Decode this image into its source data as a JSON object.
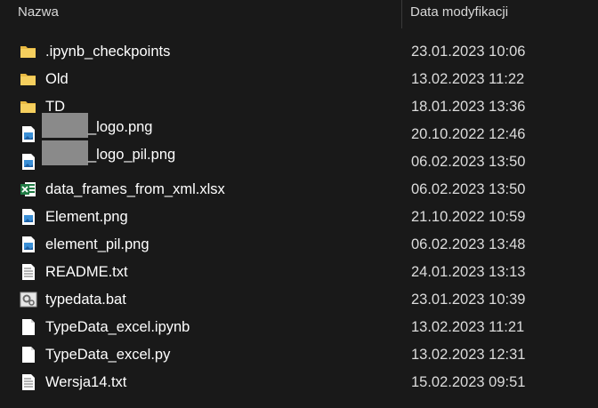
{
  "header": {
    "name_label": "Nazwa",
    "date_label": "Data modyfikacji"
  },
  "files": [
    {
      "name": ".ipynb_checkpoints",
      "date": "23.01.2023 10:06",
      "icon": "folder-icon"
    },
    {
      "name": "Old",
      "date": "13.02.2023 11:22",
      "icon": "folder-icon"
    },
    {
      "name": "TD",
      "date": "18.01.2023 13:36",
      "icon": "folder-icon"
    },
    {
      "name": "_logo.png",
      "date": "20.10.2022 12:46",
      "icon": "image-file-icon",
      "redacted": true
    },
    {
      "name": "_logo_pil.png",
      "date": "06.02.2023 13:50",
      "icon": "image-file-icon",
      "redacted": true
    },
    {
      "name": "data_frames_from_xml.xlsx",
      "date": "06.02.2023 13:50",
      "icon": "excel-file-icon"
    },
    {
      "name": "Element.png",
      "date": "21.10.2022 10:59",
      "icon": "image-file-icon"
    },
    {
      "name": "element_pil.png",
      "date": "06.02.2023 13:48",
      "icon": "image-file-icon"
    },
    {
      "name": "README.txt",
      "date": "24.01.2023 13:13",
      "icon": "text-file-icon"
    },
    {
      "name": "typedata.bat",
      "date": "23.01.2023 10:39",
      "icon": "batch-file-icon"
    },
    {
      "name": "TypeData_excel.ipynb",
      "date": "13.02.2023 11:21",
      "icon": "blank-file-icon"
    },
    {
      "name": "TypeData_excel.py",
      "date": "13.02.2023 12:31",
      "icon": "blank-file-icon"
    },
    {
      "name": "Wersja14.txt",
      "date": "15.02.2023 09:51",
      "icon": "text-file-icon"
    }
  ],
  "colors": {
    "background": "#191919",
    "folder": "#f3c94f",
    "excel": "#1f7a43",
    "image": "#3a8fd6"
  }
}
